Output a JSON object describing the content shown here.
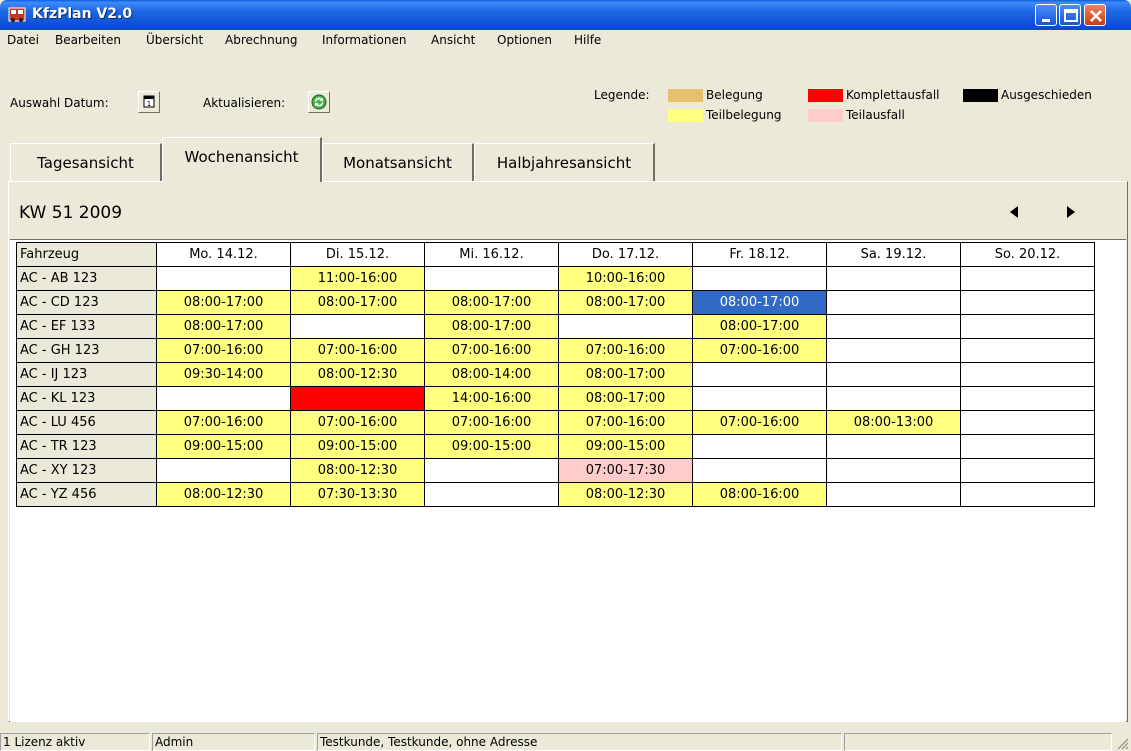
{
  "window": {
    "title": "KfzPlan V2.0",
    "colors": {
      "titlebar": "#1b66e3",
      "close": "#d9582e"
    }
  },
  "menu": {
    "items": [
      "Datei",
      "Bearbeiten",
      "Übersicht",
      "Abrechnung",
      "Informationen",
      "Ansicht",
      "Optionen",
      "Hilfe"
    ]
  },
  "toolbar": {
    "date_label": "Auswahl Datum:",
    "refresh_label": "Aktualisieren:",
    "date_icon": "calendar-icon",
    "refresh_icon": "refresh-icon"
  },
  "legend": {
    "label": "Legende:",
    "items": [
      {
        "text": "Belegung",
        "color": "#e7c06e"
      },
      {
        "text": "Teilbelegung",
        "color": "#ffff80"
      },
      {
        "text": "Komplettausfall",
        "color": "#ff0000"
      },
      {
        "text": "Teilausfall",
        "color": "#ffcccc"
      },
      {
        "text": "Ausgeschieden",
        "color": "#000000"
      }
    ]
  },
  "tabs": [
    {
      "label": "Tagesansicht",
      "active": false
    },
    {
      "label": "Wochenansicht",
      "active": true
    },
    {
      "label": "Monatsansicht",
      "active": false
    },
    {
      "label": "Halbjahresansicht",
      "active": false
    }
  ],
  "week": {
    "title": "KW 51 2009",
    "prev_icon": "arrow-left-icon",
    "next_icon": "arrow-right-icon"
  },
  "schedule": {
    "columns": [
      "Fahrzeug",
      "Mo. 14.12.",
      "Di. 15.12.",
      "Mi. 16.12.",
      "Do. 17.12.",
      "Fr. 18.12.",
      "Sa. 19.12.",
      "So. 20.12."
    ],
    "rows": [
      {
        "vehicle": "AC - AB 123",
        "cells": [
          {
            "text": "",
            "kind": "empty"
          },
          {
            "text": "11:00-16:00",
            "kind": "teil"
          },
          {
            "text": "",
            "kind": "empty"
          },
          {
            "text": "10:00-16:00",
            "kind": "teil"
          },
          {
            "text": "",
            "kind": "empty"
          },
          {
            "text": "",
            "kind": "empty"
          },
          {
            "text": "",
            "kind": "empty"
          }
        ]
      },
      {
        "vehicle": "AC - CD 123",
        "cells": [
          {
            "text": "08:00-17:00",
            "kind": "teil"
          },
          {
            "text": "08:00-17:00",
            "kind": "teil"
          },
          {
            "text": "08:00-17:00",
            "kind": "teil"
          },
          {
            "text": "08:00-17:00",
            "kind": "teil"
          },
          {
            "text": "08:00-17:00",
            "kind": "selected"
          },
          {
            "text": "",
            "kind": "empty"
          },
          {
            "text": "",
            "kind": "empty"
          }
        ]
      },
      {
        "vehicle": "AC - EF 133",
        "cells": [
          {
            "text": "08:00-17:00",
            "kind": "teil"
          },
          {
            "text": "",
            "kind": "empty"
          },
          {
            "text": "08:00-17:00",
            "kind": "teil"
          },
          {
            "text": "",
            "kind": "empty"
          },
          {
            "text": "08:00-17:00",
            "kind": "teil"
          },
          {
            "text": "",
            "kind": "empty"
          },
          {
            "text": "",
            "kind": "empty"
          }
        ]
      },
      {
        "vehicle": "AC - GH 123",
        "cells": [
          {
            "text": "07:00-16:00",
            "kind": "teil"
          },
          {
            "text": "07:00-16:00",
            "kind": "teil"
          },
          {
            "text": "07:00-16:00",
            "kind": "teil"
          },
          {
            "text": "07:00-16:00",
            "kind": "teil"
          },
          {
            "text": "07:00-16:00",
            "kind": "teil"
          },
          {
            "text": "",
            "kind": "empty"
          },
          {
            "text": "",
            "kind": "empty"
          }
        ]
      },
      {
        "vehicle": "AC - IJ 123",
        "cells": [
          {
            "text": "09:30-14:00",
            "kind": "teil"
          },
          {
            "text": "08:00-12:30",
            "kind": "teil"
          },
          {
            "text": "08:00-14:00",
            "kind": "teil"
          },
          {
            "text": "08:00-17:00",
            "kind": "teil"
          },
          {
            "text": "",
            "kind": "empty"
          },
          {
            "text": "",
            "kind": "empty"
          },
          {
            "text": "",
            "kind": "empty"
          }
        ]
      },
      {
        "vehicle": "AC - KL 123",
        "cells": [
          {
            "text": "",
            "kind": "empty"
          },
          {
            "text": "",
            "kind": "komplett"
          },
          {
            "text": "14:00-16:00",
            "kind": "teil"
          },
          {
            "text": "08:00-17:00",
            "kind": "teil"
          },
          {
            "text": "",
            "kind": "empty"
          },
          {
            "text": "",
            "kind": "empty"
          },
          {
            "text": "",
            "kind": "empty"
          }
        ]
      },
      {
        "vehicle": "AC - LU 456",
        "cells": [
          {
            "text": "07:00-16:00",
            "kind": "teil"
          },
          {
            "text": "07:00-16:00",
            "kind": "teil"
          },
          {
            "text": "07:00-16:00",
            "kind": "teil"
          },
          {
            "text": "07:00-16:00",
            "kind": "teil"
          },
          {
            "text": "07:00-16:00",
            "kind": "teil"
          },
          {
            "text": "08:00-13:00",
            "kind": "teil"
          },
          {
            "text": "",
            "kind": "empty"
          }
        ]
      },
      {
        "vehicle": "AC - TR 123",
        "cells": [
          {
            "text": "09:00-15:00",
            "kind": "teil"
          },
          {
            "text": "09:00-15:00",
            "kind": "teil"
          },
          {
            "text": "09:00-15:00",
            "kind": "teil"
          },
          {
            "text": "09:00-15:00",
            "kind": "teil"
          },
          {
            "text": "",
            "kind": "empty"
          },
          {
            "text": "",
            "kind": "empty"
          },
          {
            "text": "",
            "kind": "empty"
          }
        ]
      },
      {
        "vehicle": "AC - XY 123",
        "cells": [
          {
            "text": "",
            "kind": "empty"
          },
          {
            "text": "08:00-12:30",
            "kind": "teil"
          },
          {
            "text": "",
            "kind": "empty"
          },
          {
            "text": "07:00-17:30",
            "kind": "teilausfall"
          },
          {
            "text": "",
            "kind": "empty"
          },
          {
            "text": "",
            "kind": "empty"
          },
          {
            "text": "",
            "kind": "empty"
          }
        ]
      },
      {
        "vehicle": "AC - YZ 456",
        "cells": [
          {
            "text": "08:00-12:30",
            "kind": "teil"
          },
          {
            "text": "07:30-13:30",
            "kind": "teil"
          },
          {
            "text": "",
            "kind": "empty"
          },
          {
            "text": "08:00-12:30",
            "kind": "teil"
          },
          {
            "text": "08:00-16:00",
            "kind": "teil"
          },
          {
            "text": "",
            "kind": "empty"
          },
          {
            "text": "",
            "kind": "empty"
          }
        ]
      }
    ]
  },
  "status": {
    "license": "1 Lizenz aktiv",
    "user": "Admin",
    "customer": "Testkunde, Testkunde, ohne Adresse"
  }
}
